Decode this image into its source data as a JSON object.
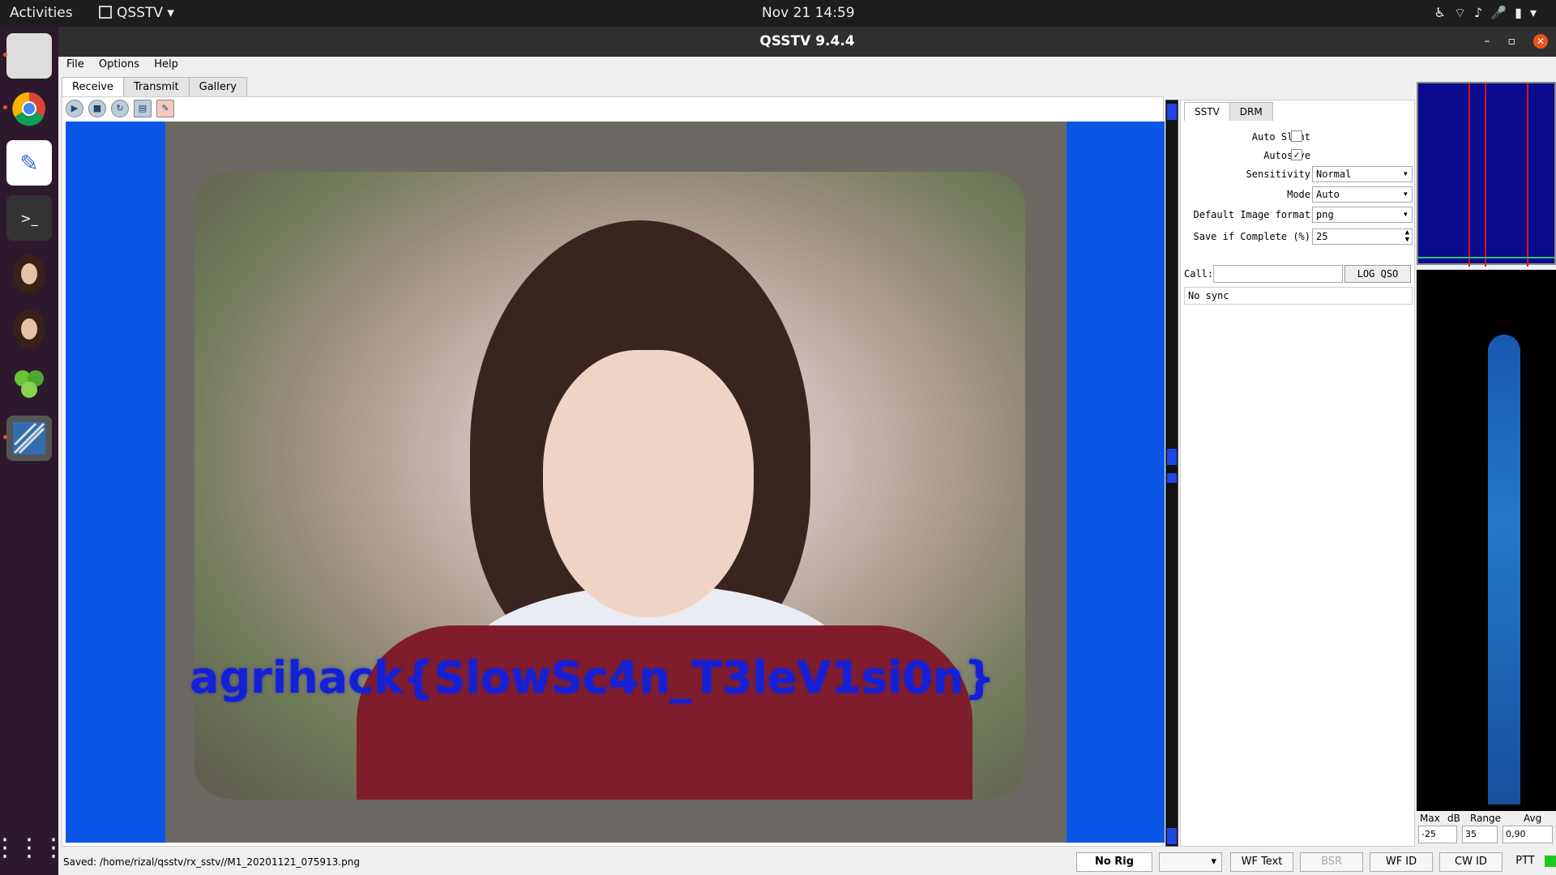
{
  "topbar": {
    "activities": "Activities",
    "app_name": "QSSTV",
    "clock": "Nov 21  14:59"
  },
  "dock": {
    "items": [
      "files-icon",
      "chrome-icon",
      "text-editor-icon",
      "terminal-icon",
      "portrait-app-icon",
      "portrait-64-app-icon",
      "green-hex-app-icon",
      "qsstv-app-icon",
      "show-apps-icon"
    ]
  },
  "window": {
    "title": "QSSTV 9.4.4"
  },
  "menu": [
    "File",
    "Options",
    "Help"
  ],
  "tabs": [
    "Receive",
    "Transmit",
    "Gallery"
  ],
  "image": {
    "flag_text": "agrihack{SlowSc4n_T3leV1si0n}"
  },
  "side": {
    "tabs": [
      "SSTV",
      "DRM"
    ],
    "auto_slant": {
      "label": "Auto Slant",
      "checked": false
    },
    "autosave": {
      "label": "Autosave",
      "checked": true,
      "mark": "✓"
    },
    "sensitivity": {
      "label": "Sensitivity",
      "value": "Normal"
    },
    "mode": {
      "label": "Mode",
      "value": "Auto"
    },
    "image_format": {
      "label": "Default Image format",
      "value": "png"
    },
    "save_complete": {
      "label": "Save if Complete (%)",
      "value": "25"
    },
    "call": {
      "label": "Call:",
      "value": ""
    },
    "log_qso": "LOG QSO",
    "sync": "No sync"
  },
  "waterfall_controls": {
    "max": "Max",
    "db": "dB",
    "range": "Range",
    "avg": "Avg",
    "max_val": "-25",
    "range_val": "35",
    "avg_val": "0,90"
  },
  "status": {
    "path": "Saved: /home/rizal/qsstv/rx_sstv//M1_20201121_075913.png",
    "rig": "No Rig",
    "wf_text": "WF Text",
    "bsr": "BSR",
    "wf_id": "WF ID",
    "cw_id": "CW ID",
    "ptt": "PTT"
  },
  "colors": {
    "accent": "#e95420",
    "canvas": "#0a56e6",
    "flag": "#1420d6"
  }
}
